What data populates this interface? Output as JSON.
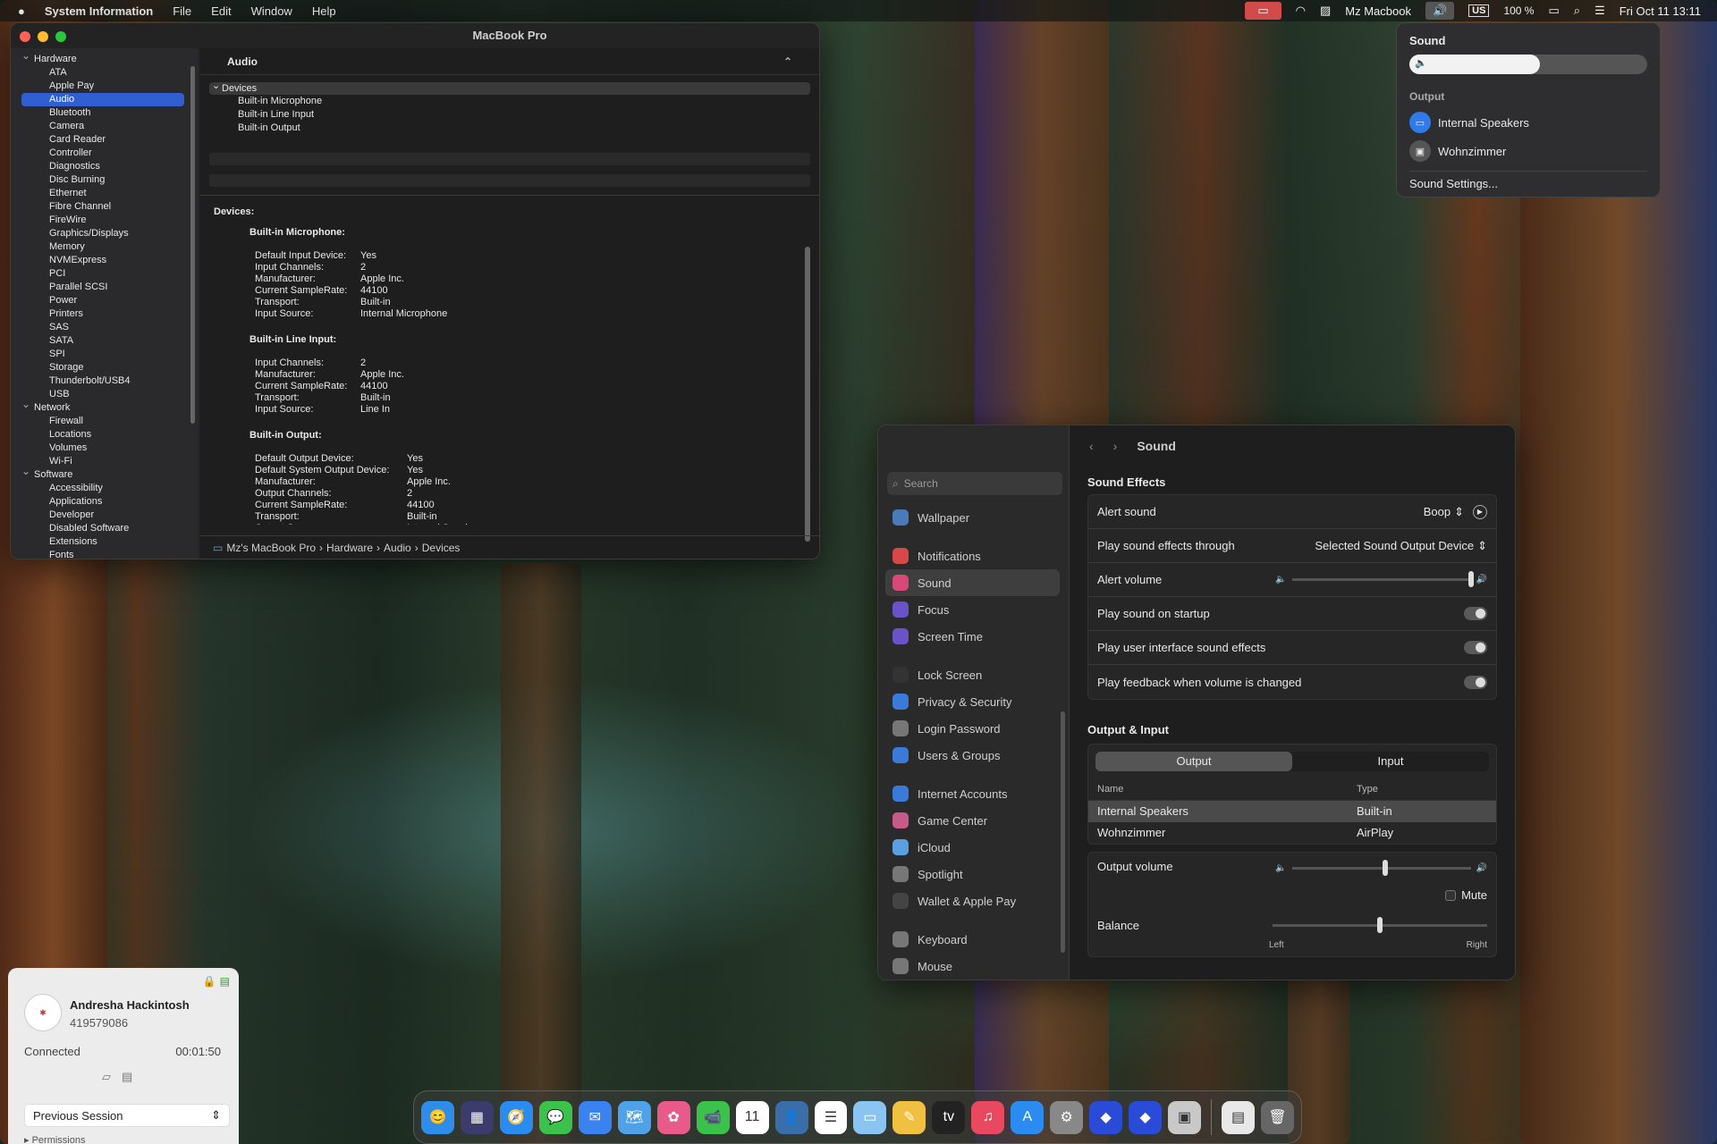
{
  "menubar": {
    "app": "System Information",
    "menus": [
      "File",
      "Edit",
      "Window",
      "Help"
    ],
    "host": "Mz Macbook",
    "lang": "US",
    "battery": "100 %",
    "datetime": "Fri Oct 11  13:11"
  },
  "si": {
    "title": "MacBook Pro",
    "sidebar": [
      {
        "t": "g",
        "label": "Hardware"
      },
      {
        "t": "i",
        "label": "ATA"
      },
      {
        "t": "i",
        "label": "Apple Pay"
      },
      {
        "t": "s",
        "label": "Audio"
      },
      {
        "t": "i",
        "label": "Bluetooth"
      },
      {
        "t": "i",
        "label": "Camera"
      },
      {
        "t": "i",
        "label": "Card Reader"
      },
      {
        "t": "i",
        "label": "Controller"
      },
      {
        "t": "i",
        "label": "Diagnostics"
      },
      {
        "t": "i",
        "label": "Disc Burning"
      },
      {
        "t": "i",
        "label": "Ethernet"
      },
      {
        "t": "i",
        "label": "Fibre Channel"
      },
      {
        "t": "i",
        "label": "FireWire"
      },
      {
        "t": "i",
        "label": "Graphics/Displays"
      },
      {
        "t": "i",
        "label": "Memory"
      },
      {
        "t": "i",
        "label": "NVMExpress"
      },
      {
        "t": "i",
        "label": "PCI"
      },
      {
        "t": "i",
        "label": "Parallel SCSI"
      },
      {
        "t": "i",
        "label": "Power"
      },
      {
        "t": "i",
        "label": "Printers"
      },
      {
        "t": "i",
        "label": "SAS"
      },
      {
        "t": "i",
        "label": "SATA"
      },
      {
        "t": "i",
        "label": "SPI"
      },
      {
        "t": "i",
        "label": "Storage"
      },
      {
        "t": "i",
        "label": "Thunderbolt/USB4"
      },
      {
        "t": "i",
        "label": "USB"
      },
      {
        "t": "g",
        "label": "Network"
      },
      {
        "t": "i",
        "label": "Firewall"
      },
      {
        "t": "i",
        "label": "Locations"
      },
      {
        "t": "i",
        "label": "Volumes"
      },
      {
        "t": "i",
        "label": "Wi-Fi"
      },
      {
        "t": "g",
        "label": "Software"
      },
      {
        "t": "i",
        "label": "Accessibility"
      },
      {
        "t": "i",
        "label": "Applications"
      },
      {
        "t": "i",
        "label": "Developer"
      },
      {
        "t": "i",
        "label": "Disabled Software"
      },
      {
        "t": "i",
        "label": "Extensions"
      },
      {
        "t": "i",
        "label": "Fonts"
      }
    ],
    "section": "Audio",
    "tree_parent": "Devices",
    "tree": [
      "Built-in Microphone",
      "Built-in Line Input",
      "Built-in Output"
    ],
    "detail_title": "Devices:",
    "devices": [
      {
        "name": "Built-in Microphone:",
        "kw": 118,
        "rows": [
          [
            "Default Input Device:",
            "Yes"
          ],
          [
            "Input Channels:",
            "2"
          ],
          [
            "Manufacturer:",
            "Apple Inc."
          ],
          [
            "Current SampleRate:",
            "44100"
          ],
          [
            "Transport:",
            "Built-in"
          ],
          [
            "Input Source:",
            "Internal Microphone"
          ]
        ]
      },
      {
        "name": "Built-in Line Input:",
        "kw": 118,
        "rows": [
          [
            "Input Channels:",
            "2"
          ],
          [
            "Manufacturer:",
            "Apple Inc."
          ],
          [
            "Current SampleRate:",
            "44100"
          ],
          [
            "Transport:",
            "Built-in"
          ],
          [
            "Input Source:",
            "Line In"
          ]
        ]
      },
      {
        "name": "Built-in Output:",
        "kw": 170,
        "rows": [
          [
            "Default Output Device:",
            "Yes"
          ],
          [
            "Default System Output Device:",
            "Yes"
          ],
          [
            "Manufacturer:",
            "Apple Inc."
          ],
          [
            "Output Channels:",
            "2"
          ],
          [
            "Current SampleRate:",
            "44100"
          ],
          [
            "Transport:",
            "Built-in"
          ],
          [
            "Output Source:",
            "Internal Speakers"
          ]
        ]
      }
    ],
    "breadcrumb": [
      "Mz's MacBook Pro",
      "Hardware",
      "Audio",
      "Devices"
    ]
  },
  "sound_menu": {
    "title": "Sound",
    "volume": 0.55,
    "output_label": "Output",
    "outputs": [
      "Internal Speakers",
      "Wohnzimmer"
    ],
    "settings": "Sound Settings..."
  },
  "settings": {
    "title": "Sound",
    "search_placeholder": "Search",
    "sidebar": [
      [
        "Wallpaper",
        "#4a7ab8"
      ],
      null,
      [
        "Notifications",
        "#d84848"
      ],
      [
        "Sound",
        "#d84878"
      ],
      [
        "Focus",
        "#6a52c8"
      ],
      [
        "Screen Time",
        "#6a52c8"
      ],
      null,
      [
        "Lock Screen",
        "#333"
      ],
      [
        "Privacy & Security",
        "#3a7ad8"
      ],
      [
        "Login Password",
        "#777"
      ],
      [
        "Users & Groups",
        "#3a7ad8"
      ],
      null,
      [
        "Internet Accounts",
        "#3a7ad8"
      ],
      [
        "Game Center",
        "#c85a8a"
      ],
      [
        "iCloud",
        "#5aa0e0"
      ],
      [
        "Spotlight",
        "#777"
      ],
      [
        "Wallet & Apple Pay",
        "#444"
      ],
      null,
      [
        "Keyboard",
        "#777"
      ],
      [
        "Mouse",
        "#777"
      ]
    ],
    "selected": "Sound",
    "effects_title": "Sound Effects",
    "alert_sound_label": "Alert sound",
    "alert_sound_value": "Boop",
    "through_label": "Play sound effects through",
    "through_value": "Selected Sound Output Device",
    "alert_volume_label": "Alert volume",
    "alert_volume": 1.0,
    "toggles": [
      "Play sound on startup",
      "Play user interface sound effects",
      "Play feedback when volume is changed"
    ],
    "oi_title": "Output & Input",
    "seg": [
      "Output",
      "Input"
    ],
    "cols": [
      "Name",
      "Type"
    ],
    "devices": [
      [
        "Internal Speakers",
        "Built-in"
      ],
      [
        "Wohnzimmer",
        "AirPlay"
      ]
    ],
    "output_volume_label": "Output volume",
    "output_volume": 0.52,
    "mute_label": "Mute",
    "balance_label": "Balance",
    "balance": 0.5,
    "left": "Left",
    "right": "Right"
  },
  "remote": {
    "name": "Andresha Hackintosh",
    "id": "419579086",
    "status": "Connected",
    "time": "00:01:50",
    "session": "Previous Session",
    "permissions": "Permissions"
  },
  "dock": [
    "😊",
    "▦",
    "🧭",
    "💬",
    "✉",
    "🗺",
    "✿",
    "📹",
    "11",
    "👤",
    "☰",
    "▭",
    "✎",
    "tv",
    "♫",
    "A",
    "⚙",
    "◆",
    "◆",
    "▣",
    "▤",
    "🗑"
  ],
  "dock_colors": [
    "#2e8de8",
    "#3b3b6e",
    "#2a8cf0",
    "#3ac24a",
    "#3a82f0",
    "#4fa2e8",
    "#e85a8a",
    "#3ac24a",
    "#ffffff",
    "#3a6ea8",
    "#ffffff",
    "#8ac4f0",
    "#f0c040",
    "#222222",
    "#e84860",
    "#2a8cf0",
    "#888888",
    "#2a4ad8",
    "#2a4ad8",
    "#c8c8c8",
    "#e8e8e8",
    "#666666"
  ]
}
